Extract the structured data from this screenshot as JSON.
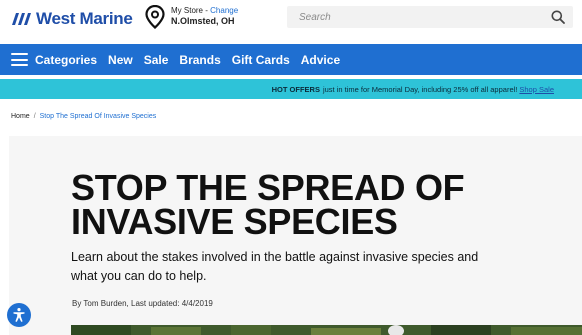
{
  "header": {
    "logo_text": "West Marine",
    "store": {
      "label": "My Store -",
      "change_label": "Change",
      "city": "N.Olmsted, OH"
    },
    "search": {
      "placeholder": "Search"
    }
  },
  "nav": {
    "items": [
      {
        "label": "Categories"
      },
      {
        "label": "New"
      },
      {
        "label": "Sale"
      },
      {
        "label": "Brands"
      },
      {
        "label": "Gift Cards"
      },
      {
        "label": "Advice"
      }
    ]
  },
  "promo": {
    "hot": "HOT OFFERS",
    "text": "just in time for Memorial Day, including 25% off all apparel!",
    "link": "Shop Sale"
  },
  "breadcrumb": {
    "home": "Home",
    "separator": "/",
    "current": "Stop The Spread Of Invasive Species"
  },
  "article": {
    "title": "STOP THE SPREAD OF INVASIVE SPECIES",
    "subtitle": "Learn about the stakes involved in the battle against invasive species and what you can do to help.",
    "byline": "By Tom Burden, Last updated: 4/4/2019"
  },
  "colors": {
    "brand_blue": "#1f6fd1",
    "logo_blue": "#1f4ea8",
    "promo_cyan": "#2ec3d8"
  },
  "icons": {
    "logo": "west-marine-logo-icon",
    "store": "location-pin-icon",
    "search": "search-icon",
    "menu": "hamburger-menu-icon",
    "accessibility": "accessibility-icon"
  }
}
